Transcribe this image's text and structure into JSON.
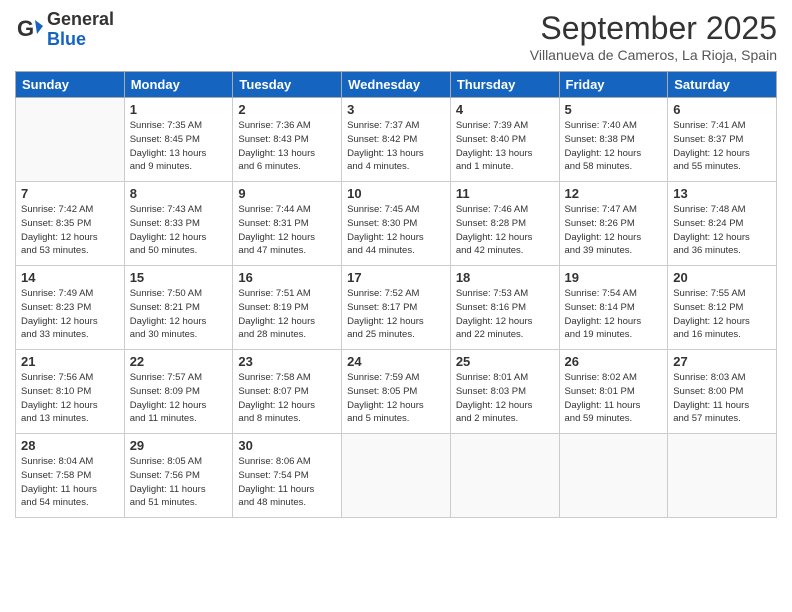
{
  "logo": {
    "general": "General",
    "blue": "Blue"
  },
  "title": "September 2025",
  "subtitle": "Villanueva de Cameros, La Rioja, Spain",
  "days": [
    "Sunday",
    "Monday",
    "Tuesday",
    "Wednesday",
    "Thursday",
    "Friday",
    "Saturday"
  ],
  "weeks": [
    [
      {
        "num": "",
        "info": ""
      },
      {
        "num": "1",
        "info": "Sunrise: 7:35 AM\nSunset: 8:45 PM\nDaylight: 13 hours\nand 9 minutes."
      },
      {
        "num": "2",
        "info": "Sunrise: 7:36 AM\nSunset: 8:43 PM\nDaylight: 13 hours\nand 6 minutes."
      },
      {
        "num": "3",
        "info": "Sunrise: 7:37 AM\nSunset: 8:42 PM\nDaylight: 13 hours\nand 4 minutes."
      },
      {
        "num": "4",
        "info": "Sunrise: 7:39 AM\nSunset: 8:40 PM\nDaylight: 13 hours\nand 1 minute."
      },
      {
        "num": "5",
        "info": "Sunrise: 7:40 AM\nSunset: 8:38 PM\nDaylight: 12 hours\nand 58 minutes."
      },
      {
        "num": "6",
        "info": "Sunrise: 7:41 AM\nSunset: 8:37 PM\nDaylight: 12 hours\nand 55 minutes."
      }
    ],
    [
      {
        "num": "7",
        "info": "Sunrise: 7:42 AM\nSunset: 8:35 PM\nDaylight: 12 hours\nand 53 minutes."
      },
      {
        "num": "8",
        "info": "Sunrise: 7:43 AM\nSunset: 8:33 PM\nDaylight: 12 hours\nand 50 minutes."
      },
      {
        "num": "9",
        "info": "Sunrise: 7:44 AM\nSunset: 8:31 PM\nDaylight: 12 hours\nand 47 minutes."
      },
      {
        "num": "10",
        "info": "Sunrise: 7:45 AM\nSunset: 8:30 PM\nDaylight: 12 hours\nand 44 minutes."
      },
      {
        "num": "11",
        "info": "Sunrise: 7:46 AM\nSunset: 8:28 PM\nDaylight: 12 hours\nand 42 minutes."
      },
      {
        "num": "12",
        "info": "Sunrise: 7:47 AM\nSunset: 8:26 PM\nDaylight: 12 hours\nand 39 minutes."
      },
      {
        "num": "13",
        "info": "Sunrise: 7:48 AM\nSunset: 8:24 PM\nDaylight: 12 hours\nand 36 minutes."
      }
    ],
    [
      {
        "num": "14",
        "info": "Sunrise: 7:49 AM\nSunset: 8:23 PM\nDaylight: 12 hours\nand 33 minutes."
      },
      {
        "num": "15",
        "info": "Sunrise: 7:50 AM\nSunset: 8:21 PM\nDaylight: 12 hours\nand 30 minutes."
      },
      {
        "num": "16",
        "info": "Sunrise: 7:51 AM\nSunset: 8:19 PM\nDaylight: 12 hours\nand 28 minutes."
      },
      {
        "num": "17",
        "info": "Sunrise: 7:52 AM\nSunset: 8:17 PM\nDaylight: 12 hours\nand 25 minutes."
      },
      {
        "num": "18",
        "info": "Sunrise: 7:53 AM\nSunset: 8:16 PM\nDaylight: 12 hours\nand 22 minutes."
      },
      {
        "num": "19",
        "info": "Sunrise: 7:54 AM\nSunset: 8:14 PM\nDaylight: 12 hours\nand 19 minutes."
      },
      {
        "num": "20",
        "info": "Sunrise: 7:55 AM\nSunset: 8:12 PM\nDaylight: 12 hours\nand 16 minutes."
      }
    ],
    [
      {
        "num": "21",
        "info": "Sunrise: 7:56 AM\nSunset: 8:10 PM\nDaylight: 12 hours\nand 13 minutes."
      },
      {
        "num": "22",
        "info": "Sunrise: 7:57 AM\nSunset: 8:09 PM\nDaylight: 12 hours\nand 11 minutes."
      },
      {
        "num": "23",
        "info": "Sunrise: 7:58 AM\nSunset: 8:07 PM\nDaylight: 12 hours\nand 8 minutes."
      },
      {
        "num": "24",
        "info": "Sunrise: 7:59 AM\nSunset: 8:05 PM\nDaylight: 12 hours\nand 5 minutes."
      },
      {
        "num": "25",
        "info": "Sunrise: 8:01 AM\nSunset: 8:03 PM\nDaylight: 12 hours\nand 2 minutes."
      },
      {
        "num": "26",
        "info": "Sunrise: 8:02 AM\nSunset: 8:01 PM\nDaylight: 11 hours\nand 59 minutes."
      },
      {
        "num": "27",
        "info": "Sunrise: 8:03 AM\nSunset: 8:00 PM\nDaylight: 11 hours\nand 57 minutes."
      }
    ],
    [
      {
        "num": "28",
        "info": "Sunrise: 8:04 AM\nSunset: 7:58 PM\nDaylight: 11 hours\nand 54 minutes."
      },
      {
        "num": "29",
        "info": "Sunrise: 8:05 AM\nSunset: 7:56 PM\nDaylight: 11 hours\nand 51 minutes."
      },
      {
        "num": "30",
        "info": "Sunrise: 8:06 AM\nSunset: 7:54 PM\nDaylight: 11 hours\nand 48 minutes."
      },
      {
        "num": "",
        "info": ""
      },
      {
        "num": "",
        "info": ""
      },
      {
        "num": "",
        "info": ""
      },
      {
        "num": "",
        "info": ""
      }
    ]
  ]
}
